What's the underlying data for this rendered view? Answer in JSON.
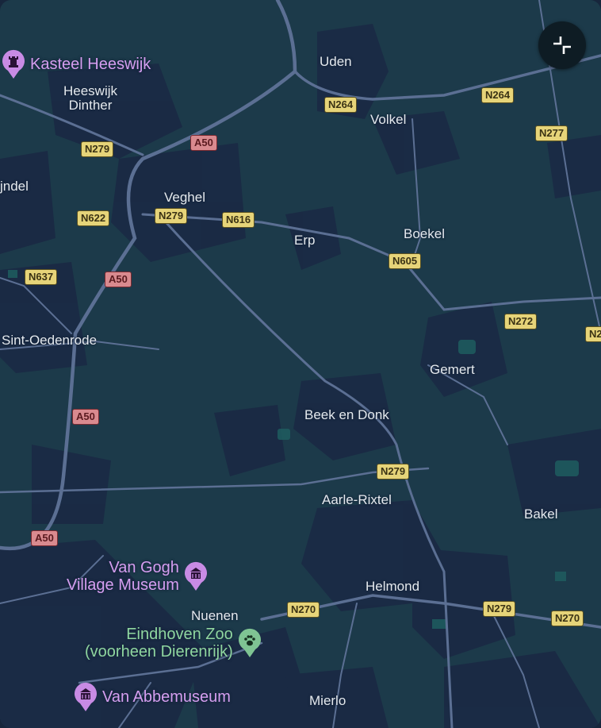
{
  "map": {
    "controls": {
      "exit_fullscreen_icon": "exit-fullscreen-icon"
    },
    "colors": {
      "background": "#1c3a4a",
      "urban": "#1a2a44",
      "road": "#5b6f93",
      "national_road_shield": "#e6d479",
      "motorway_shield": "#d98a8f",
      "poi_museum": "#d59ef0",
      "poi_zoo": "#8fd6a0"
    },
    "places": {
      "uden": "Uden",
      "heeswijk_dinther_1": "Heeswijk",
      "heeswijk_dinther_2": "Dinther",
      "volkel": "Volkel",
      "veghel": "Veghel",
      "schijndel": "jndel",
      "erp": "Erp",
      "boekel": "Boekel",
      "sint_oedenrode": "Sint-Oedenrode",
      "gemert": "Gemert",
      "beek_en_donk": "Beek en Donk",
      "aarle_rixtel": "Aarle-Rixtel",
      "bakel": "Bakel",
      "helmond": "Helmond",
      "nuenen": "Nuenen",
      "mierlo": "Mierlo"
    },
    "road_shields": {
      "n264_a": "N264",
      "n264_b": "N264",
      "n277": "N277",
      "a50_top": "A50",
      "n279_top": "N279",
      "n622": "N622",
      "n279_veghel": "N279",
      "n616": "N616",
      "n605": "N605",
      "n637": "N637",
      "a50_mid": "A50",
      "n272": "N272",
      "n2_edge": "N2",
      "a50_low": "A50",
      "n279_mid": "N279",
      "a50_bottom": "A50",
      "n270_a": "N270",
      "n279_helmond": "N279",
      "n270_b": "N270"
    },
    "pois": {
      "kasteel_heeswijk": {
        "label": "Kasteel Heeswijk",
        "icon": "castle-icon"
      },
      "van_gogh": {
        "label_1": "Van Gogh",
        "label_2": "Village Museum",
        "icon": "museum-icon"
      },
      "zoo": {
        "label_1": "Eindhoven Zoo",
        "label_2": "(voorheen Dierenrijk)",
        "icon": "paw-icon"
      },
      "van_abbe": {
        "label": "Van Abbemuseum",
        "icon": "museum-icon"
      }
    }
  }
}
